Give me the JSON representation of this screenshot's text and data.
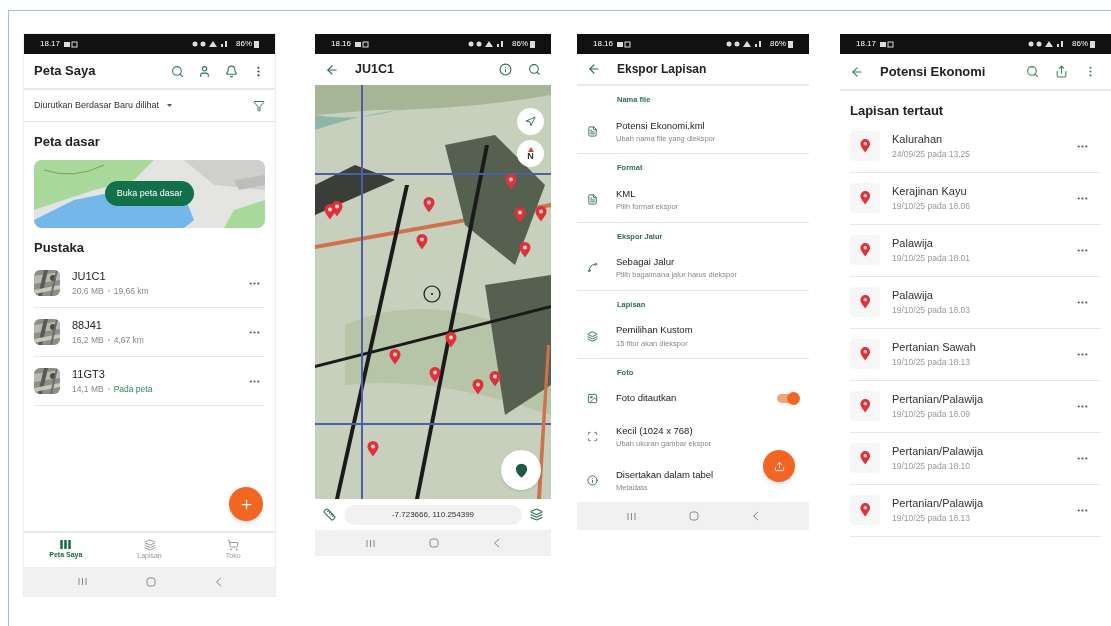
{
  "my_maps": {
    "status_bar": {
      "time": "18.17",
      "battery": "86%"
    },
    "title": "Peta Saya",
    "sort": "Diurutkan Berdasar Baru dilihat",
    "basemap_heading": "Peta dasar",
    "basemap_button": "Buka peta dasar",
    "library_heading": "Pustaka",
    "maps": [
      {
        "name": "JU1C1",
        "size": "20,6 MB",
        "detail": "19,66 km",
        "on_map": false
      },
      {
        "name": "88J41",
        "size": "16,2 MB",
        "detail": "4,67 km",
        "on_map": false
      },
      {
        "name": "11GT3",
        "size": "14,1 MB",
        "detail": "Pada peta",
        "on_map": true
      }
    ],
    "nav": [
      {
        "label": "Peta Saya",
        "selected": true
      },
      {
        "label": "Lapisan",
        "selected": false
      },
      {
        "label": "Toko",
        "selected": false
      }
    ]
  },
  "map_view": {
    "status_bar": {
      "time": "18.16",
      "battery": "86%"
    },
    "title": "JU1C1",
    "compass_label": "N",
    "coordinates": "-7.723666, 110.254399"
  },
  "export_layer": {
    "status_bar": {
      "time": "18.16",
      "battery": "86%"
    },
    "title": "Ekspor Lapisan",
    "sections": [
      {
        "heading": "Nama file",
        "items": [
          {
            "kind": "option",
            "title": "Potensi Ekonomi.kml",
            "subtitle": "Ubah nama file yang diekspor"
          }
        ]
      },
      {
        "heading": "Format",
        "items": [
          {
            "kind": "option",
            "title": "KML",
            "subtitle": "Pilih format ekspor"
          }
        ]
      },
      {
        "heading": "Ekspor Jalur",
        "items": [
          {
            "kind": "option",
            "title": "Sebagai Jalur",
            "subtitle": "Pilih bagaimana jalur harus diekspor"
          }
        ]
      },
      {
        "heading": "Lapisan",
        "items": [
          {
            "kind": "option",
            "title": "Pemilihan Kustom",
            "subtitle": "15 fitur akan diekspor"
          }
        ]
      },
      {
        "heading": "Foto",
        "items": [
          {
            "kind": "toggle",
            "title": "Foto ditautkan",
            "on": true
          },
          {
            "kind": "option",
            "title": "Kecil (1024 x 768)",
            "subtitle": "Ubah ukuran gambar ekspor"
          },
          {
            "kind": "option",
            "title": "Disertakan dalam tabel",
            "subtitle": "Metadata"
          }
        ]
      }
    ]
  },
  "layer_detail": {
    "status_bar": {
      "time": "18.17",
      "battery": "86%"
    },
    "title": "Potensi Ekonomi",
    "heading": "Lapisan tertaut",
    "layers": [
      {
        "name": "Kalurahan",
        "date": "24/09/25 pada 13.25"
      },
      {
        "name": "Kerajinan Kayu",
        "date": "19/10/25 pada 18.06"
      },
      {
        "name": "Palawija",
        "date": "19/10/25 pada 18.01"
      },
      {
        "name": "Palawija",
        "date": "19/10/25 pada 18.03"
      },
      {
        "name": "Pertanian Sawah",
        "date": "19/10/25 pada 18.13"
      },
      {
        "name": "Pertanian/Palawija",
        "date": "19/10/25 pada 18.09"
      },
      {
        "name": "Pertanian/Palawija",
        "date": "19/10/25 pada 18.10"
      },
      {
        "name": "Pertanian/Palawija",
        "date": "19/10/25 pada 18.13"
      }
    ]
  }
}
